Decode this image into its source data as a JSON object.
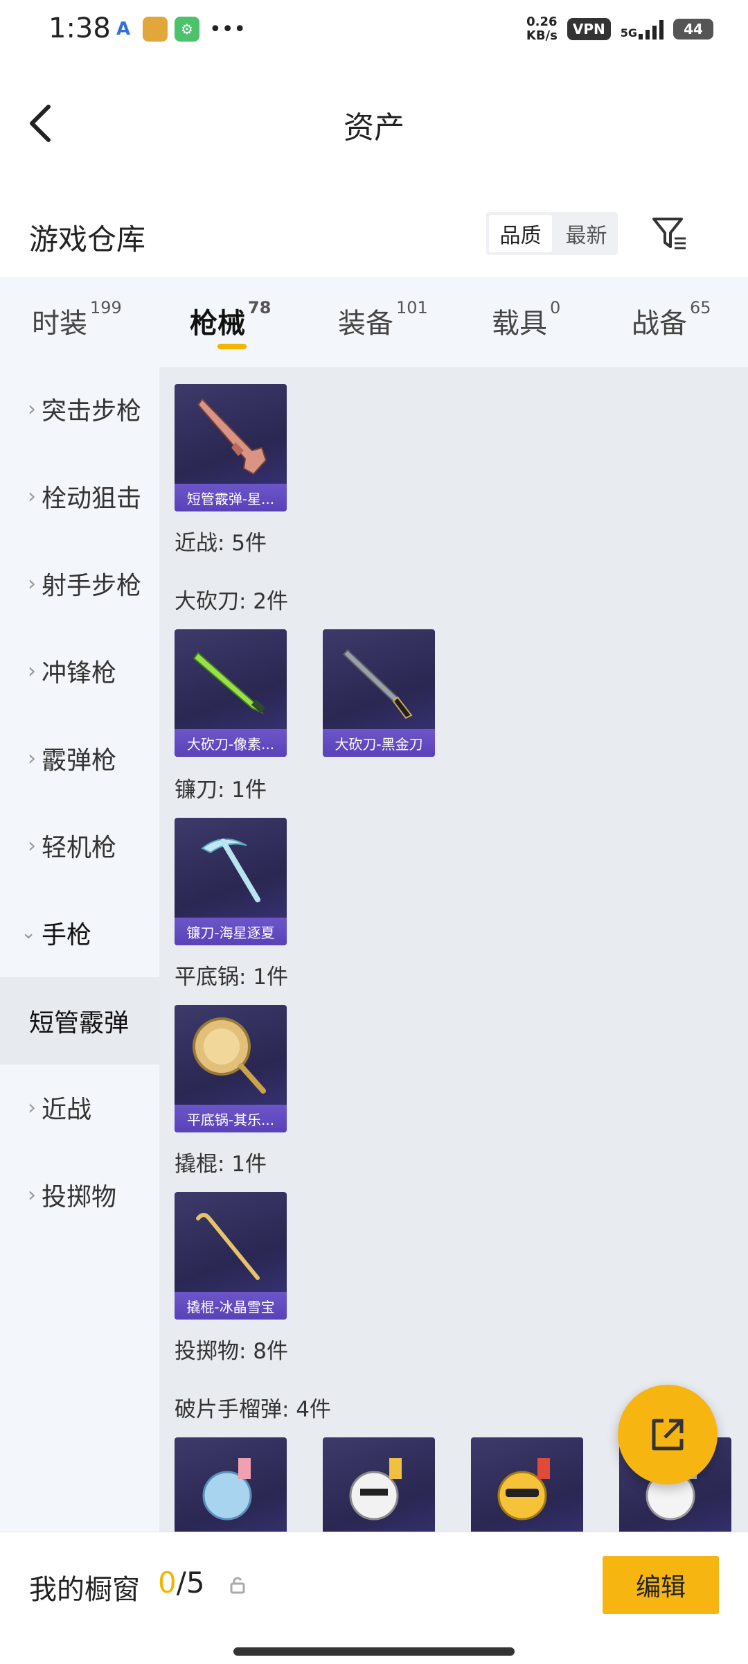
{
  "status": {
    "time": "1:38",
    "net_speed_value": "0.26",
    "net_speed_unit": "KB/s",
    "vpn": "VPN",
    "network": "5G",
    "battery": "44"
  },
  "header": {
    "title": "资产",
    "back_icon": "chevron-left-icon"
  },
  "warehouse": {
    "title": "游戏仓库",
    "sort_options": [
      "品质",
      "最新"
    ],
    "sort_selected": "品质",
    "filter_icon": "filter-icon"
  },
  "tabs": [
    {
      "label": "时装",
      "count": "199"
    },
    {
      "label": "枪械",
      "count": "78"
    },
    {
      "label": "装备",
      "count": "101"
    },
    {
      "label": "载具",
      "count": "0"
    },
    {
      "label": "战备",
      "count": "65"
    }
  ],
  "active_tab": "枪械",
  "sidebar": {
    "items": [
      {
        "label": "突击步枪"
      },
      {
        "label": "栓动狙击"
      },
      {
        "label": "射手步枪"
      },
      {
        "label": "冲锋枪"
      },
      {
        "label": "霰弹枪"
      },
      {
        "label": "轻机枪"
      },
      {
        "label": "手枪"
      },
      {
        "label": "短管霰弹"
      },
      {
        "label": "近战"
      },
      {
        "label": "投掷物"
      }
    ],
    "selected": "短管霰弹"
  },
  "main": {
    "items": [
      {
        "card": "短管霰弹-星..."
      },
      {
        "section": "近战: 5件"
      },
      {
        "group": "大砍刀: 2件",
        "cards": [
          "大砍刀-像素...",
          "大砍刀-黑金刀"
        ]
      },
      {
        "group": "镰刀: 1件",
        "cards": [
          "镰刀-海星逐夏"
        ]
      },
      {
        "group": "平底锅: 1件",
        "cards": [
          "平底锅-其乐..."
        ]
      },
      {
        "group": "撬棍: 1件",
        "cards": [
          "撬棍-冰晶雪宝"
        ]
      },
      {
        "section": "投掷物: 8件"
      },
      {
        "group": "破片手榴弹: 4件",
        "cards": [
          "",
          "",
          "",
          ""
        ]
      }
    ]
  },
  "share_icon": "external-link-icon",
  "bottom": {
    "label": "我的橱窗",
    "count_current": "0",
    "count_separator": "/",
    "count_total": "5",
    "lock_icon": "lock-icon",
    "edit_label": "编辑"
  },
  "colors": {
    "accent": "#f7b512",
    "card_bar": "#5942b8",
    "card_bg": "#2a2752"
  }
}
